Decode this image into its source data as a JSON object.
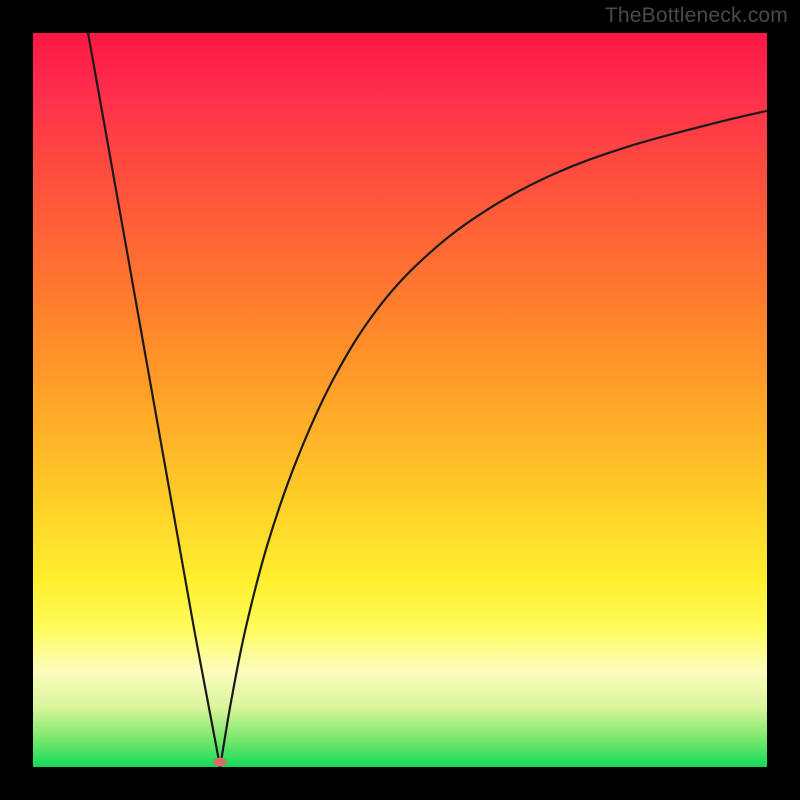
{
  "watermark": "TheBottleneck.com",
  "marker": {
    "x_pct": 25.5,
    "y_pct": 99.3
  },
  "chart_data": {
    "type": "line",
    "title": "",
    "xlabel": "",
    "ylabel": "",
    "xlim": [
      0,
      100
    ],
    "ylim": [
      0,
      100
    ],
    "series": [
      {
        "name": "left-segment",
        "x": [
          7.5,
          10,
          14,
          18,
          22,
          25.5
        ],
        "values": [
          100,
          86,
          63.5,
          41,
          18.5,
          0
        ]
      },
      {
        "name": "right-segment",
        "x": [
          25.5,
          27,
          29,
          32,
          36,
          41,
          47,
          54,
          62,
          71,
          81,
          92,
          100
        ],
        "values": [
          0,
          9,
          19,
          30.5,
          42,
          53,
          62.5,
          70,
          76,
          80.8,
          84.5,
          87.5,
          89.4
        ]
      }
    ],
    "gradient_stops": [
      {
        "pct": 0,
        "meaning": "high-bottleneck",
        "color": "#ff1744"
      },
      {
        "pct": 50,
        "meaning": "medium",
        "color": "#ffb327"
      },
      {
        "pct": 80,
        "meaning": "low",
        "color": "#fffc5a"
      },
      {
        "pct": 100,
        "meaning": "optimal",
        "color": "#14d95a"
      }
    ],
    "annotations": [
      {
        "type": "marker",
        "x": 25.5,
        "y": 0.7,
        "style": "ellipse-red"
      }
    ]
  }
}
